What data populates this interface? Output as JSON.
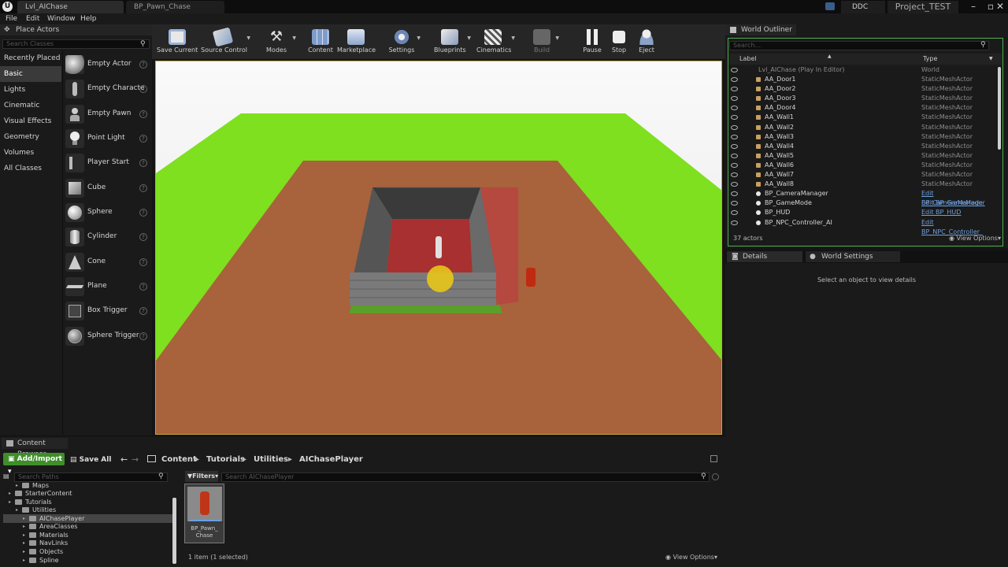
{
  "app": {
    "tabs": [
      {
        "label": "Lvl_AIChase"
      },
      {
        "label": "BP_Pawn_Chase"
      }
    ],
    "ddc_label": "DDC",
    "project_name": "Project_TEST",
    "menu": [
      "File",
      "Edit",
      "Window",
      "Help"
    ]
  },
  "place_actors": {
    "title": "Place Actors",
    "search_placeholder": "Search Classes",
    "categories": [
      "Recently Placed",
      "Basic",
      "Lights",
      "Cinematic",
      "Visual Effects",
      "Geometry",
      "Volumes",
      "All Classes"
    ],
    "selected_category": "Basic",
    "actors": [
      "Empty Actor",
      "Empty Characte",
      "Empty Pawn",
      "Point Light",
      "Player Start",
      "Cube",
      "Sphere",
      "Cylinder",
      "Cone",
      "Plane",
      "Box Trigger",
      "Sphere Trigger"
    ]
  },
  "toolbar": {
    "buttons": [
      {
        "label": "Save Current",
        "icon": "save-icon"
      },
      {
        "label": "Source Control",
        "icon": "source-control-icon"
      },
      {
        "label": "Modes",
        "icon": "modes-icon"
      },
      {
        "label": "Content",
        "icon": "content-icon"
      },
      {
        "label": "Marketplace",
        "icon": "marketplace-icon"
      },
      {
        "label": "Settings",
        "icon": "settings-icon"
      },
      {
        "label": "Blueprints",
        "icon": "blueprints-icon"
      },
      {
        "label": "Cinematics",
        "icon": "cinematics-icon"
      },
      {
        "label": "Build",
        "icon": "build-icon"
      },
      {
        "label": "Pause",
        "icon": "pause-icon"
      },
      {
        "label": "Stop",
        "icon": "stop-icon"
      },
      {
        "label": "Eject",
        "icon": "eject-icon"
      }
    ]
  },
  "outliner": {
    "title": "World Outliner",
    "search_placeholder": "Search...",
    "col_label": "Label",
    "col_type": "Type",
    "root": {
      "name": "Lvl_AIChase (Play In Editor)",
      "type": "World"
    },
    "rows": [
      {
        "name": "AA_Door1",
        "type": "StaticMeshActor"
      },
      {
        "name": "AA_Door2",
        "type": "StaticMeshActor"
      },
      {
        "name": "AA_Door3",
        "type": "StaticMeshActor"
      },
      {
        "name": "AA_Door4",
        "type": "StaticMeshActor"
      },
      {
        "name": "AA_Wall1",
        "type": "StaticMeshActor"
      },
      {
        "name": "AA_Wall2",
        "type": "StaticMeshActor"
      },
      {
        "name": "AA_Wall3",
        "type": "StaticMeshActor"
      },
      {
        "name": "AA_Wall4",
        "type": "StaticMeshActor"
      },
      {
        "name": "AA_Wall5",
        "type": "StaticMeshActor"
      },
      {
        "name": "AA_Wall6",
        "type": "StaticMeshActor"
      },
      {
        "name": "AA_Wall7",
        "type": "StaticMeshActor"
      },
      {
        "name": "AA_Wall8",
        "type": "StaticMeshActor"
      },
      {
        "name": "BP_CameraManager",
        "type": "Edit BP_CameraManager",
        "link": true
      },
      {
        "name": "BP_GameMode",
        "type": "Edit BP_GameMode",
        "link": true
      },
      {
        "name": "BP_HUD",
        "type": "Edit BP_HUD",
        "link": true
      },
      {
        "name": "BP_NPC_Controller_AI",
        "type": "Edit BP_NPC_Controller_",
        "link": true
      }
    ],
    "count": "37 actors",
    "view_options": "View Options"
  },
  "details": {
    "tab_details": "Details",
    "tab_world_settings": "World Settings",
    "empty_message": "Select an object to view details"
  },
  "content_browser": {
    "title": "Content Browser",
    "add_import": "Add/Import",
    "save_all": "Save All",
    "breadcrumb": [
      "Content",
      "Tutorials",
      "Utilities",
      "AIChasePlayer"
    ],
    "search_paths_placeholder": "Search Paths",
    "filters": "Filters",
    "search_placeholder": "Search AIChasePlayer",
    "tree": [
      {
        "label": "Maps",
        "depth": 2
      },
      {
        "label": "StarterContent",
        "depth": 1
      },
      {
        "label": "Tutorials",
        "depth": 1
      },
      {
        "label": "Utilities",
        "depth": 2
      },
      {
        "label": "AIChasePlayer",
        "depth": 3,
        "selected": true
      },
      {
        "label": "AreaClasses",
        "depth": 3
      },
      {
        "label": "Materials",
        "depth": 3
      },
      {
        "label": "NavLinks",
        "depth": 3
      },
      {
        "label": "Objects",
        "depth": 3
      },
      {
        "label": "Spline",
        "depth": 3
      }
    ],
    "asset": {
      "name": "BP_Pawn_\nChase"
    },
    "status": "1 item (1 selected)",
    "view_options": "View Options"
  },
  "colors": {
    "accent_green": "#4caf50",
    "selection_yellow": "#c8a43a",
    "ground_green": "#7ee01e",
    "floor_brown": "#a8623c"
  }
}
